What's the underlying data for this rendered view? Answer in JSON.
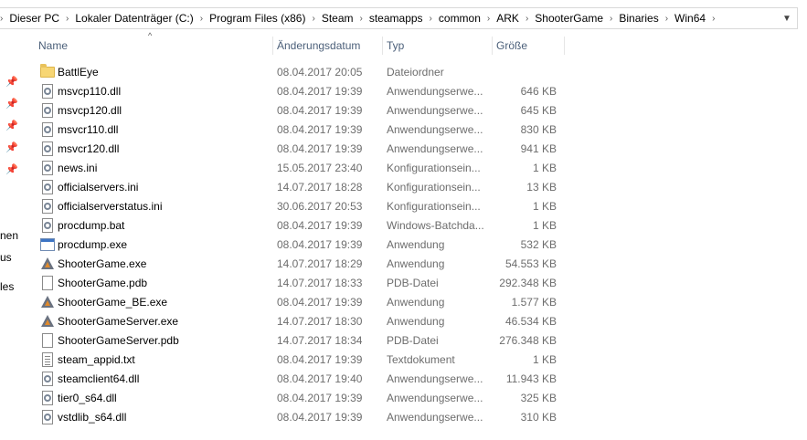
{
  "breadcrumb": [
    "Dieser PC",
    "Lokaler Datenträger (C:)",
    "Program Files (x86)",
    "Steam",
    "steamapps",
    "common",
    "ARK",
    "ShooterGame",
    "Binaries",
    "Win64"
  ],
  "navpane": {
    "labels": [
      "nen",
      "us",
      "les"
    ]
  },
  "columns": {
    "name": "Name",
    "date": "Änderungsdatum",
    "type": "Typ",
    "size": "Größe"
  },
  "files": [
    {
      "name": "BattlEye",
      "date": "08.04.2017 20:05",
      "type": "Dateiordner",
      "size": "",
      "icon": "folder-icon"
    },
    {
      "name": "msvcp110.dll",
      "date": "08.04.2017 19:39",
      "type": "Anwendungserwe...",
      "size": "646 KB",
      "icon": "dll-file-icon"
    },
    {
      "name": "msvcp120.dll",
      "date": "08.04.2017 19:39",
      "type": "Anwendungserwe...",
      "size": "645 KB",
      "icon": "dll-file-icon"
    },
    {
      "name": "msvcr110.dll",
      "date": "08.04.2017 19:39",
      "type": "Anwendungserwe...",
      "size": "830 KB",
      "icon": "dll-file-icon"
    },
    {
      "name": "msvcr120.dll",
      "date": "08.04.2017 19:39",
      "type": "Anwendungserwe...",
      "size": "941 KB",
      "icon": "dll-file-icon"
    },
    {
      "name": "news.ini",
      "date": "15.05.2017 23:40",
      "type": "Konfigurationsein...",
      "size": "1 KB",
      "icon": "ini-file-icon"
    },
    {
      "name": "officialservers.ini",
      "date": "14.07.2017 18:28",
      "type": "Konfigurationsein...",
      "size": "13 KB",
      "icon": "ini-file-icon"
    },
    {
      "name": "officialserverstatus.ini",
      "date": "30.06.2017 20:53",
      "type": "Konfigurationsein...",
      "size": "1 KB",
      "icon": "ini-file-icon"
    },
    {
      "name": "procdump.bat",
      "date": "08.04.2017 19:39",
      "type": "Windows-Batchda...",
      "size": "1 KB",
      "icon": "bat-file-icon"
    },
    {
      "name": "procdump.exe",
      "date": "08.04.2017 19:39",
      "type": "Anwendung",
      "size": "532 KB",
      "icon": "exe-window-icon"
    },
    {
      "name": "ShooterGame.exe",
      "date": "14.07.2017 18:29",
      "type": "Anwendung",
      "size": "54.553 KB",
      "icon": "ark-logo-icon"
    },
    {
      "name": "ShooterGame.pdb",
      "date": "14.07.2017 18:33",
      "type": "PDB-Datei",
      "size": "292.348 KB",
      "icon": "blank-file-icon"
    },
    {
      "name": "ShooterGame_BE.exe",
      "date": "08.04.2017 19:39",
      "type": "Anwendung",
      "size": "1.577 KB",
      "icon": "ark-logo-icon"
    },
    {
      "name": "ShooterGameServer.exe",
      "date": "14.07.2017 18:30",
      "type": "Anwendung",
      "size": "46.534 KB",
      "icon": "ark-logo-icon"
    },
    {
      "name": "ShooterGameServer.pdb",
      "date": "14.07.2017 18:34",
      "type": "PDB-Datei",
      "size": "276.348 KB",
      "icon": "blank-file-icon"
    },
    {
      "name": "steam_appid.txt",
      "date": "08.04.2017 19:39",
      "type": "Textdokument",
      "size": "1 KB",
      "icon": "text-file-icon"
    },
    {
      "name": "steamclient64.dll",
      "date": "08.04.2017 19:40",
      "type": "Anwendungserwe...",
      "size": "11.943 KB",
      "icon": "dll-file-icon"
    },
    {
      "name": "tier0_s64.dll",
      "date": "08.04.2017 19:39",
      "type": "Anwendungserwe...",
      "size": "325 KB",
      "icon": "dll-file-icon"
    },
    {
      "name": "vstdlib_s64.dll",
      "date": "08.04.2017 19:39",
      "type": "Anwendungserwe...",
      "size": "310 KB",
      "icon": "dll-file-icon"
    }
  ]
}
